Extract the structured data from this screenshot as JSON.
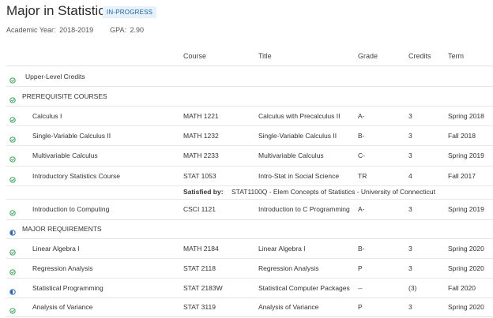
{
  "header": {
    "title": "Major in Statistics",
    "status_badge": "IN-PROGRESS",
    "academic_year_label": "Academic Year:",
    "academic_year": "2018-2019",
    "gpa_label": "GPA:",
    "gpa": "2.90"
  },
  "columns": {
    "course": "Course",
    "title": "Title",
    "grade": "Grade",
    "credits": "Credits",
    "term": "Term"
  },
  "colors": {
    "complete": "#2e9e4f",
    "in_progress": "#2060a8"
  },
  "rows": [
    {
      "type": "group",
      "label": "Upper-Level Credits",
      "status": "complete"
    },
    {
      "type": "section",
      "label": "PREREQUISITE COURSES",
      "status": "complete"
    },
    {
      "type": "course",
      "name": "Calculus I",
      "course": "MATH 1221",
      "title": "Calculus with Precalculus II",
      "grade": "A-",
      "credits": "3",
      "term": "Spring 2018",
      "status": "complete"
    },
    {
      "type": "course",
      "name": "Single-Variable Calculus II",
      "course": "MATH 1232",
      "title": "Single-Variable Calculus II",
      "grade": "B-",
      "credits": "3",
      "term": "Fall 2018",
      "status": "complete"
    },
    {
      "type": "course",
      "name": "Multivariable Calculus",
      "course": "MATH 2233",
      "title": "Multivariable Calculus",
      "grade": "C-",
      "credits": "3",
      "term": "Spring 2019",
      "status": "complete"
    },
    {
      "type": "course",
      "name": "Introductory Statistics Course",
      "course": "STAT 1053",
      "title": "Intro-Stat in Social Science",
      "grade": "TR",
      "credits": "4",
      "term": "Fall 2017",
      "status": "complete"
    },
    {
      "type": "satisfied",
      "label": "Satisfied by:",
      "value": "STAT1100Q - Elem Concepts of Statistics - University of Connecticut"
    },
    {
      "type": "course",
      "name": "Introduction to Computing",
      "course": "CSCI 1121",
      "title": "Introduction to C Programming",
      "grade": "A-",
      "credits": "3",
      "term": "Spring 2019",
      "status": "complete"
    },
    {
      "type": "section",
      "label": "MAJOR REQUIREMENTS",
      "status": "in_progress"
    },
    {
      "type": "course",
      "name": "Linear Algebra I",
      "course": "MATH 2184",
      "title": "Linear Algebra I",
      "grade": "B-",
      "credits": "3",
      "term": "Spring 2020",
      "status": "complete"
    },
    {
      "type": "course",
      "name": "Regression Analysis",
      "course": "STAT 2118",
      "title": "Regression Analysis",
      "grade": "P",
      "credits": "3",
      "term": "Spring 2020",
      "status": "complete"
    },
    {
      "type": "course",
      "name": "Statistical Programming",
      "course": "STAT 2183W",
      "title": "Statistical Computer Packages",
      "grade": "--",
      "credits": "(3)",
      "term": "Fall 2020",
      "status": "in_progress"
    },
    {
      "type": "course",
      "name": "Analysis of Variance",
      "course": "STAT 3119",
      "title": "Analysis of Variance",
      "grade": "P",
      "credits": "3",
      "term": "Spring 2020",
      "status": "complete"
    }
  ]
}
